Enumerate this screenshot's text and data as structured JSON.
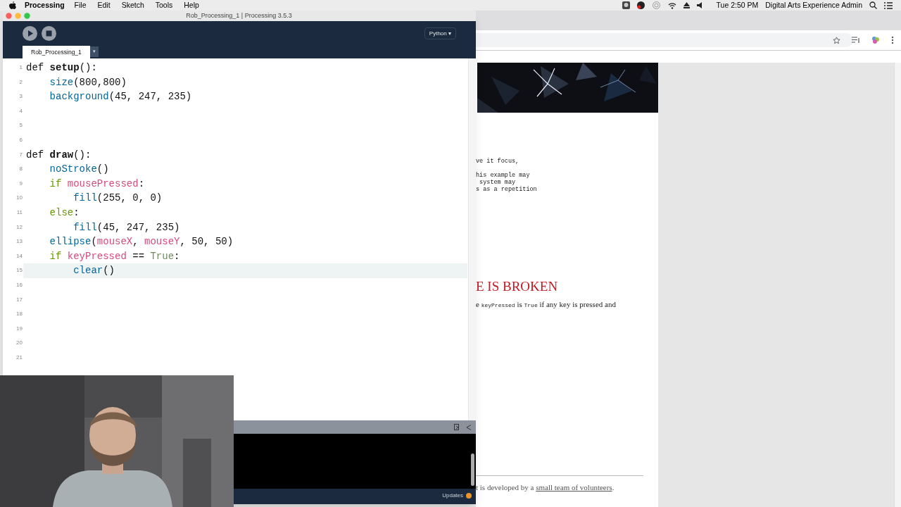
{
  "menubar": {
    "app": "Processing",
    "menus": [
      "File",
      "Edit",
      "Sketch",
      "Tools",
      "Help"
    ],
    "clock": "Tue 2:50 PM",
    "user": "Digital Arts Experience Admin"
  },
  "window": {
    "title": "Rob_Processing_1 | Processing 3.5.3",
    "mode": "Python ▾",
    "tabs": [
      {
        "label": "Rob_Processing_1",
        "selected": true
      }
    ],
    "tab_menu": "▾",
    "editor": {
      "lines": [
        {
          "number": "1",
          "current": false,
          "tokens": [
            {
              "text": "def ",
              "kind": "plain"
            },
            {
              "text": "setup",
              "kind": "defname"
            },
            {
              "text": "():",
              "kind": "plain"
            }
          ]
        },
        {
          "number": "2",
          "current": false,
          "tokens": [
            {
              "text": "    size",
              "kind": "function"
            },
            {
              "text": "(800,800)",
              "kind": "plain"
            }
          ]
        },
        {
          "number": "3",
          "current": false,
          "tokens": [
            {
              "text": "    background",
              "kind": "function"
            },
            {
              "text": "(45, 247, 235)",
              "kind": "plain"
            }
          ]
        },
        {
          "number": "4",
          "current": false
        },
        {
          "number": "5",
          "current": false
        },
        {
          "number": "6",
          "current": false
        },
        {
          "number": "7",
          "current": false,
          "tokens": [
            {
              "text": "def ",
              "kind": "plain"
            },
            {
              "text": "draw",
              "kind": "defname"
            },
            {
              "text": "():",
              "kind": "plain"
            }
          ]
        },
        {
          "number": "8",
          "current": false,
          "tokens": [
            {
              "text": "    noStroke",
              "kind": "function"
            },
            {
              "text": "()",
              "kind": "plain"
            }
          ]
        },
        {
          "number": "9",
          "current": false,
          "tokens": [
            {
              "text": "    if ",
              "kind": "keyword"
            },
            {
              "text": "mousePressed",
              "kind": "variable"
            },
            {
              "text": ":",
              "kind": "plain"
            }
          ]
        },
        {
          "number": "10",
          "current": false,
          "tokens": [
            {
              "text": "        fill",
              "kind": "function"
            },
            {
              "text": "(255, 0, 0)",
              "kind": "plain"
            }
          ]
        },
        {
          "number": "11",
          "current": false,
          "tokens": [
            {
              "text": "    else",
              "kind": "keyword"
            },
            {
              "text": ":",
              "kind": "plain"
            }
          ]
        },
        {
          "number": "12",
          "current": false,
          "tokens": [
            {
              "text": "        fill",
              "kind": "function"
            },
            {
              "text": "(45, 247, 235)",
              "kind": "plain"
            }
          ]
        },
        {
          "number": "13",
          "current": false,
          "tokens": [
            {
              "text": "    ellipse",
              "kind": "function"
            },
            {
              "text": "(",
              "kind": "plain"
            },
            {
              "text": "mouseX",
              "kind": "variable"
            },
            {
              "text": ", ",
              "kind": "plain"
            },
            {
              "text": "mouseY",
              "kind": "variable"
            },
            {
              "text": ", 50, 50)",
              "kind": "plain"
            }
          ]
        },
        {
          "number": "14",
          "current": false,
          "tokens": [
            {
              "text": "    if ",
              "kind": "keyword"
            },
            {
              "text": "keyPressed",
              "kind": "variable"
            },
            {
              "text": " == ",
              "kind": "plain"
            },
            {
              "text": "True",
              "kind": "constant"
            },
            {
              "text": ":",
              "kind": "plain"
            }
          ]
        },
        {
          "number": "15",
          "current": true,
          "tokens": [
            {
              "text": "        clear",
              "kind": "function"
            },
            {
              "text": "()",
              "kind": "plain"
            }
          ]
        },
        {
          "number": "16",
          "current": false
        },
        {
          "number": "17",
          "current": false
        },
        {
          "number": "18",
          "current": false
        },
        {
          "number": "19",
          "current": false
        },
        {
          "number": "20",
          "current": false
        },
        {
          "number": "21",
          "current": false
        }
      ]
    },
    "status": "Updates"
  },
  "browser": {
    "code_lines": [
      "ve it focus,",
      "his example may",
      " system may",
      "s as a repetition"
    ],
    "heading": "E IS BROKEN",
    "paragraph": [
      {
        "text": "e ",
        "kind": "text"
      },
      {
        "text": "keyPressed",
        "kind": "code"
      },
      {
        "text": " is ",
        "kind": "text"
      },
      {
        "text": "True",
        "kind": "code"
      },
      {
        "text": " if any key is pressed and",
        "kind": "text"
      }
    ],
    "footer_text": "t is developed by a ",
    "footer_link": "small team of volunteers",
    "footer_end": "."
  }
}
